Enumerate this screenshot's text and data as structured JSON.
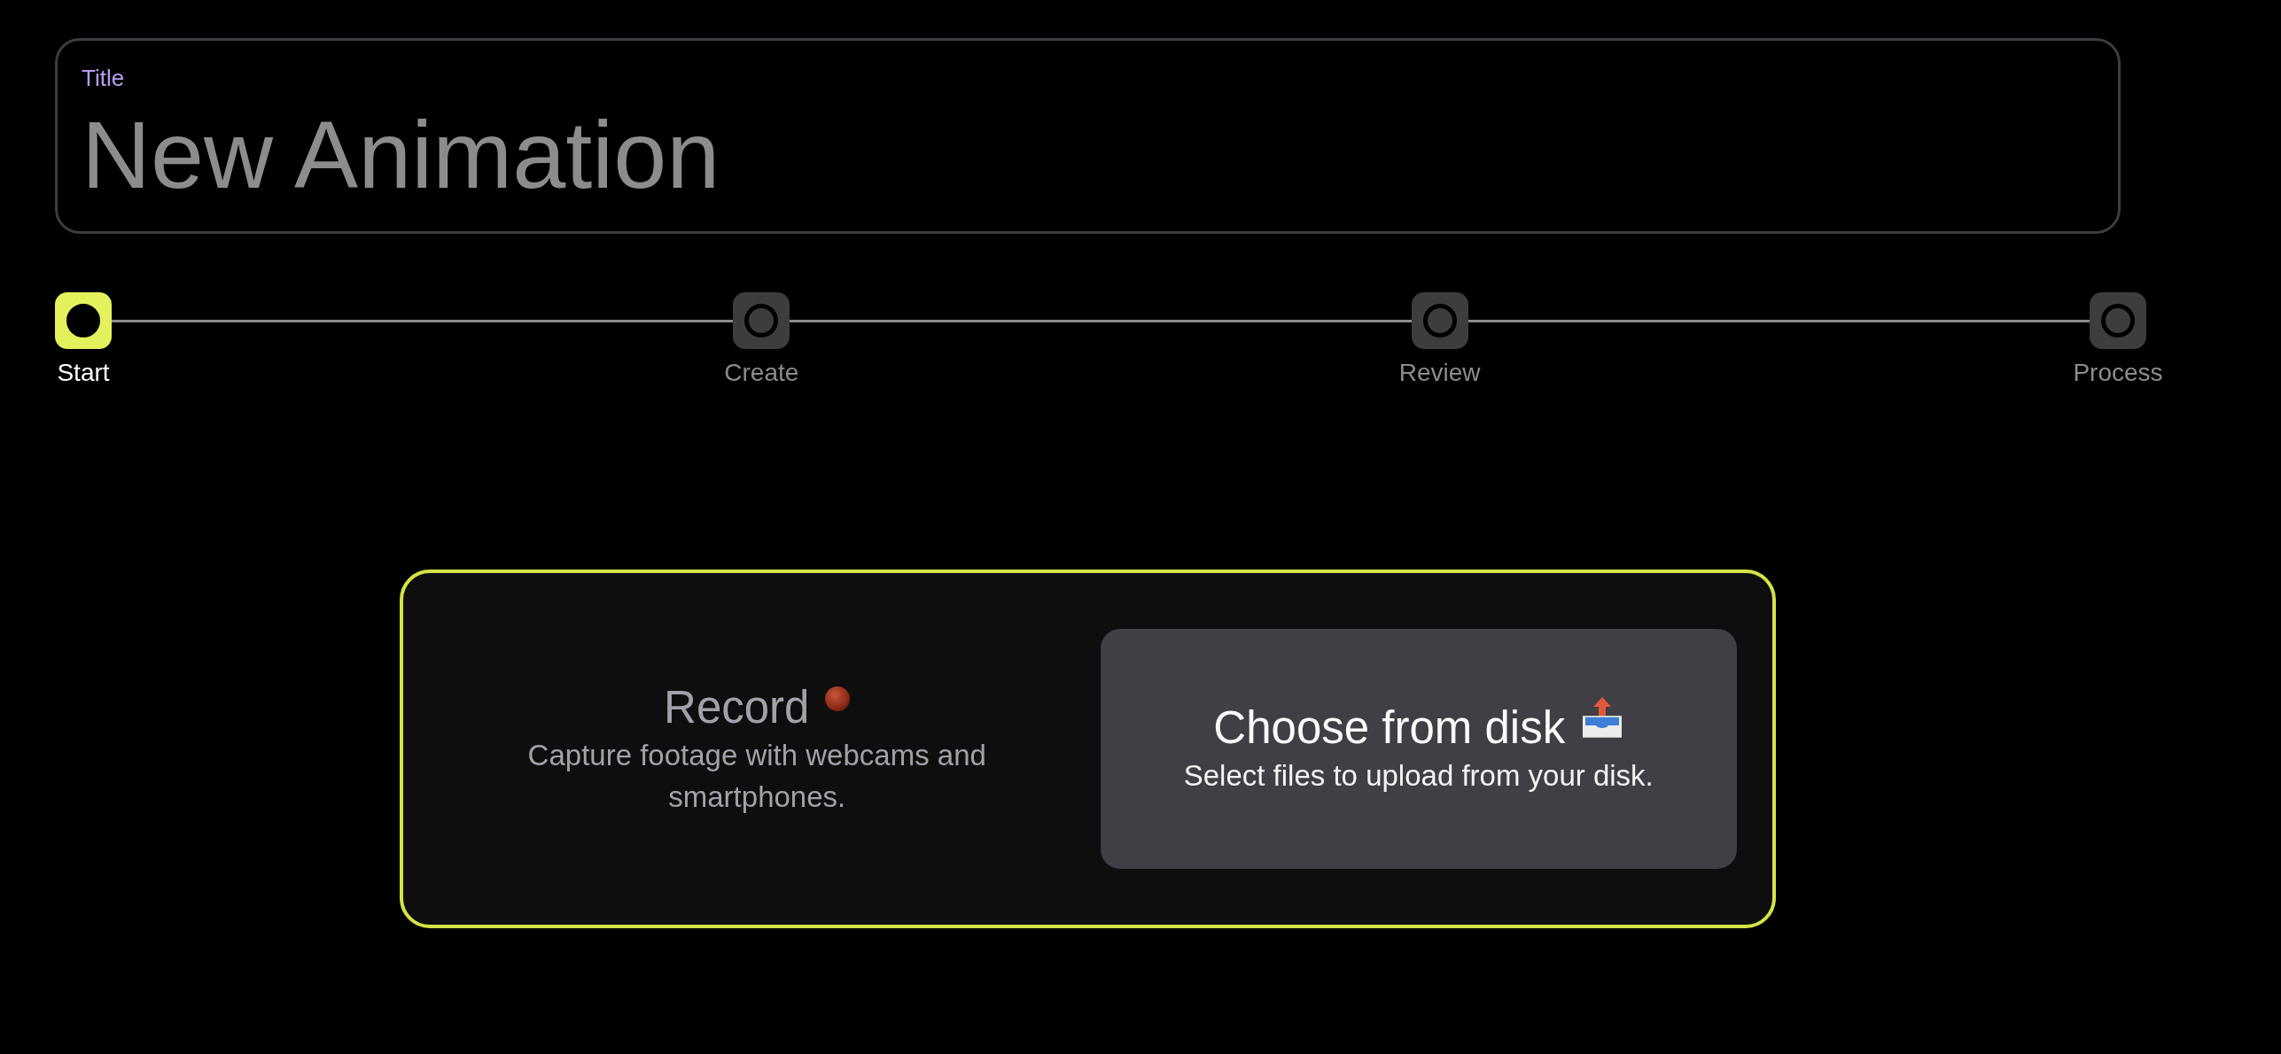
{
  "title_field": {
    "label": "Title",
    "value": "New Animation"
  },
  "steps": [
    {
      "label": "Start",
      "selected": true
    },
    {
      "label": "Create",
      "selected": false
    },
    {
      "label": "Review",
      "selected": false
    },
    {
      "label": "Process",
      "selected": false
    }
  ],
  "options": [
    {
      "kind": "record",
      "title": "Record",
      "description": "Capture footage with webcams and smartphones.",
      "selected": false
    },
    {
      "kind": "upload",
      "title": "Choose from disk",
      "description": "Select files to upload from your disk.",
      "selected": true
    }
  ]
}
